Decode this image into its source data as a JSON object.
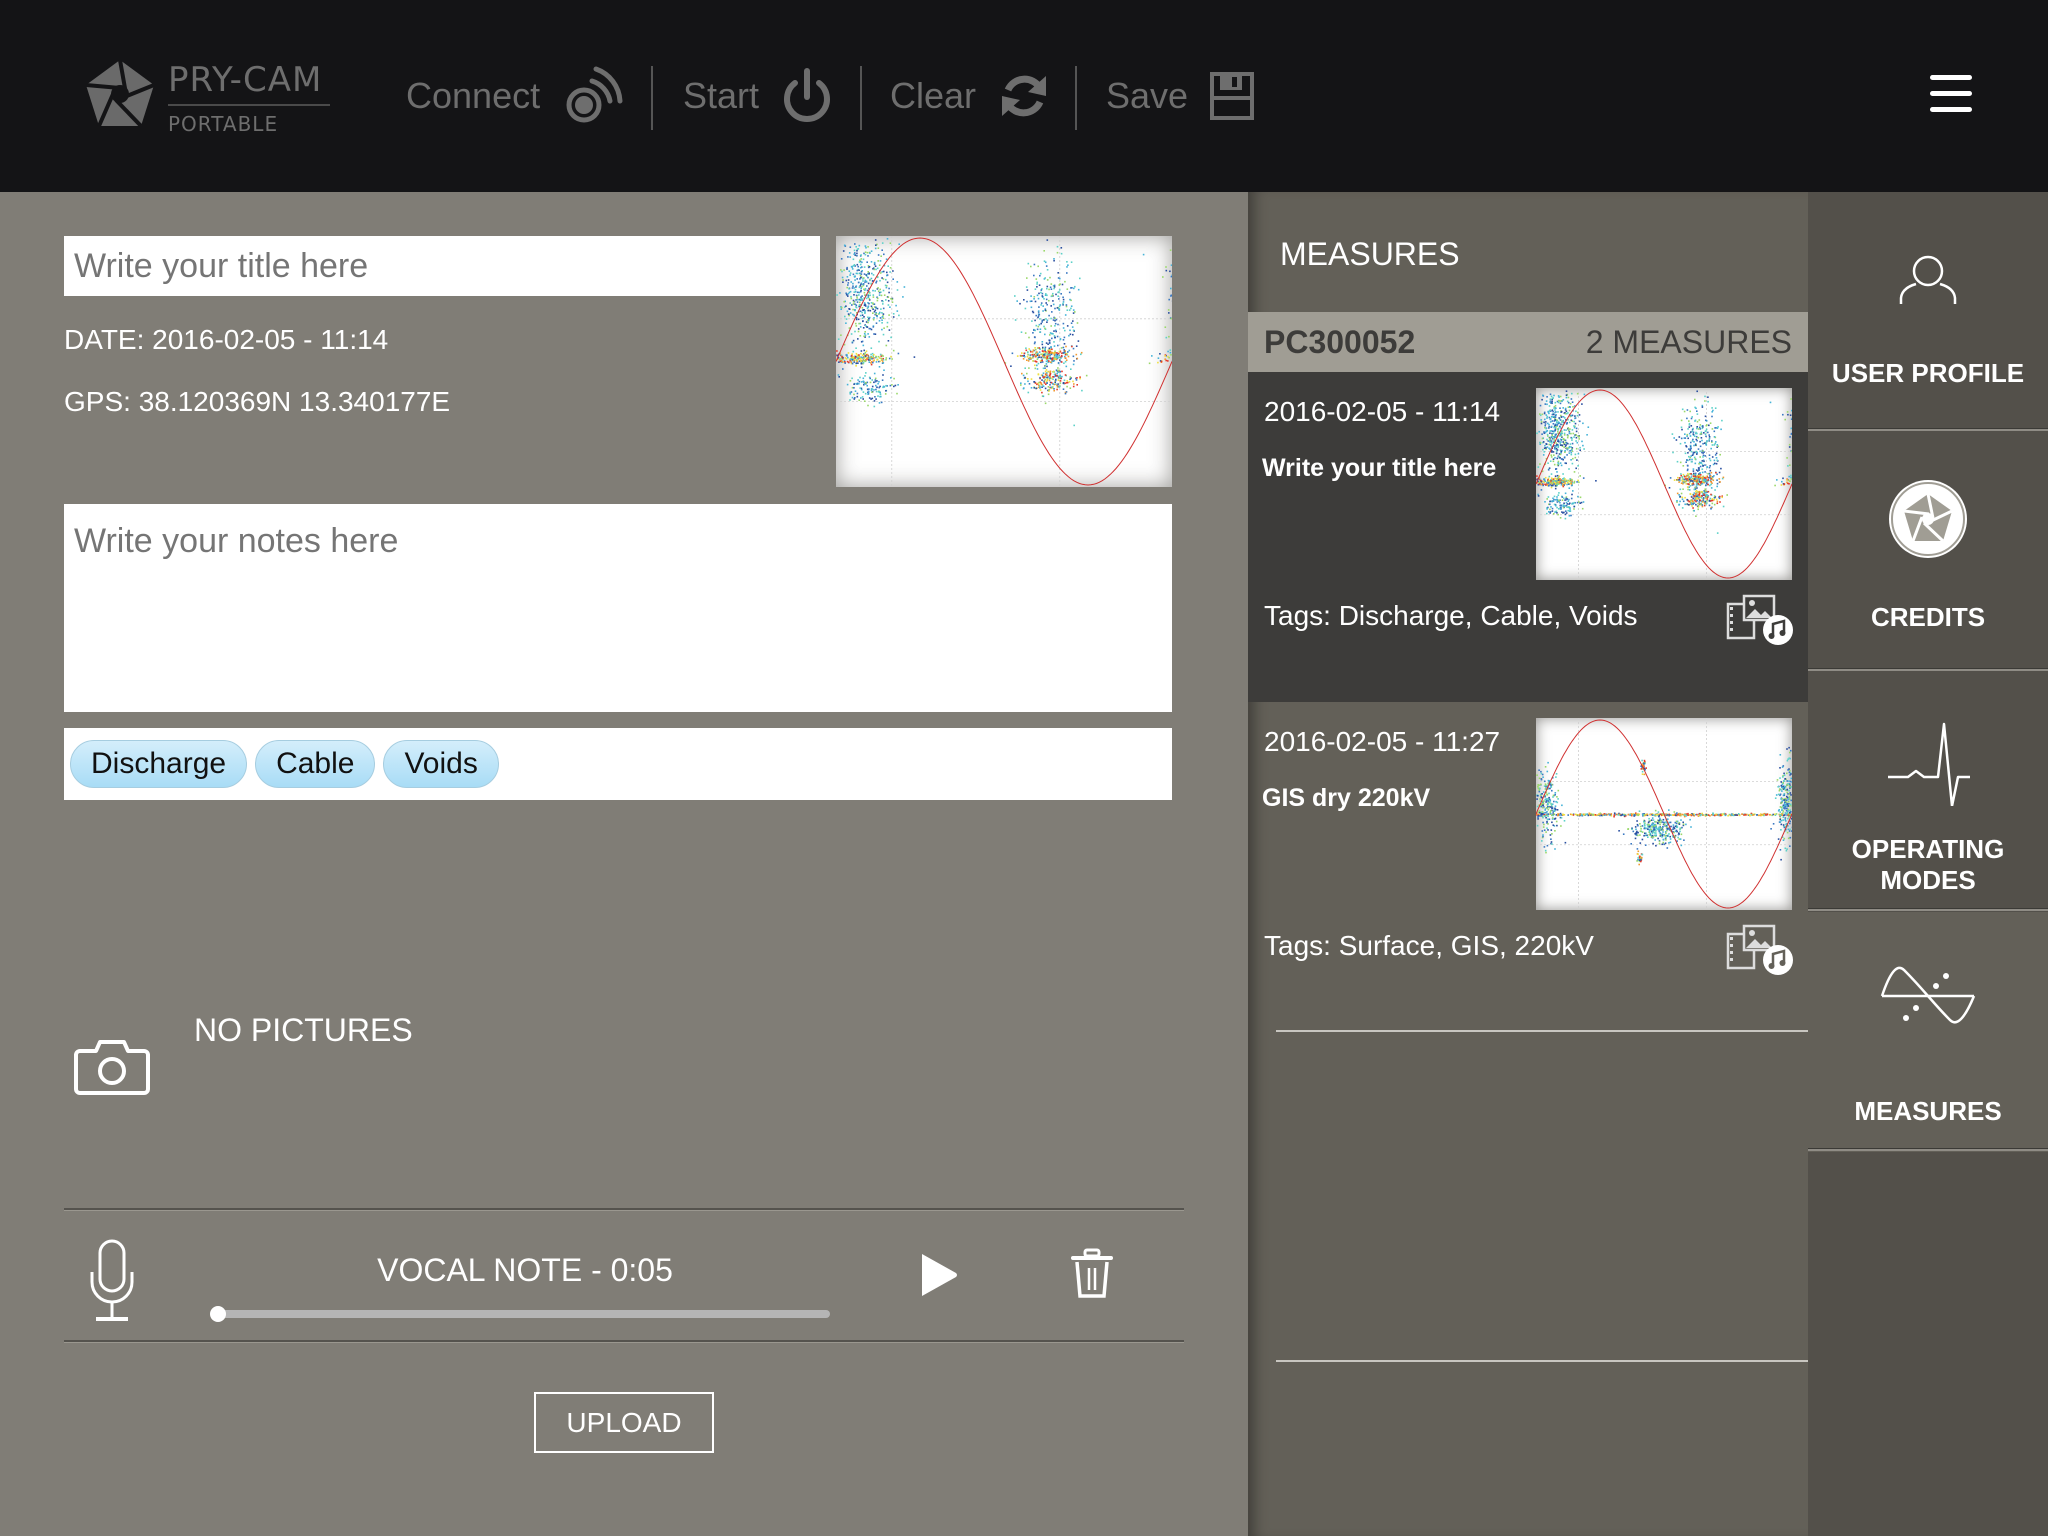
{
  "app": {
    "brand": "PRY-CAM",
    "brand_sub": "PORTABLE"
  },
  "toolbar": {
    "connect_label": "Connect",
    "start_label": "Start",
    "clear_label": "Clear",
    "save_label": "Save",
    "menu_icon": "hamburger-icon"
  },
  "editor": {
    "title_placeholder": "Write your title here",
    "date_text": "DATE: 2016-02-05  -  11:14",
    "gps_text": "GPS: 38.120369N 13.340177E",
    "notes_placeholder": "Write your notes here",
    "tags": [
      "Discharge",
      "Cable",
      "Voids"
    ],
    "pictures_text": "NO PICTURES",
    "vocal_note_label": "VOCAL NOTE - 0:05",
    "vocal_note_progress": 0,
    "upload_label": "UPLOAD"
  },
  "measures_panel": {
    "title": "MEASURES",
    "group": {
      "id": "PC300052",
      "count_label": "2 MEASURES"
    },
    "items": [
      {
        "datetime": "2016-02-05 - 11:14",
        "title": "Write your title here",
        "tags_text": "Tags: Discharge, Cable, Voids",
        "selected": true,
        "media_icon": "media-attachments-icon"
      },
      {
        "datetime": "2016-02-05 - 11:27",
        "title": "GIS dry 220kV",
        "tags_text": "Tags: Surface, GIS, 220kV",
        "selected": false,
        "media_icon": "media-attachments-icon"
      }
    ]
  },
  "sidebar": {
    "items": [
      {
        "label": "USER PROFILE",
        "icon": "user-icon",
        "active": false
      },
      {
        "label": "CREDITS",
        "icon": "aperture-logo-icon",
        "active": false
      },
      {
        "label": "OPERATING\nMODES",
        "icon": "heartbeat-icon",
        "active": false
      },
      {
        "label": "MEASURES",
        "icon": "sine-wave-icon",
        "active": true
      }
    ]
  },
  "colors": {
    "header_bg": "#141416",
    "editor_bg": "#807d76",
    "measures_bg": "#636058",
    "selected_card_bg": "#3d3c3a",
    "group_header_bg": "#a09d94",
    "sidebar_bg": "#53504a",
    "tag_chip": "#a8dcf6",
    "sine_curve": "#d03030"
  },
  "prpd_thumbnails": {
    "main": "pattern_a",
    "items": [
      "pattern_a",
      "pattern_b"
    ],
    "patterns": {
      "pattern_a": {
        "description": "phase-resolved PD pattern, clusters near 10-60 deg and 190-250 deg",
        "clusters": [
          {
            "phase": 30,
            "amp": 0.55,
            "spread_phase": 25,
            "spread_amp": 0.35,
            "n": 500
          },
          {
            "phase": 25,
            "amp": 0.03,
            "spread_phase": 30,
            "spread_amp": 0.04,
            "n": 220,
            "hot": true
          },
          {
            "phase": 35,
            "amp": -0.2,
            "spread_phase": 22,
            "spread_amp": 0.1,
            "n": 120
          },
          {
            "phase": 230,
            "amp": 0.35,
            "spread_phase": 25,
            "spread_amp": 0.45,
            "n": 320
          },
          {
            "phase": 225,
            "amp": 0.05,
            "spread_phase": 25,
            "spread_amp": 0.05,
            "n": 200,
            "hot": true
          },
          {
            "phase": 230,
            "amp": -0.15,
            "spread_phase": 22,
            "spread_amp": 0.08,
            "n": 180,
            "hot": true
          }
        ]
      },
      "pattern_b": {
        "description": "phase-resolved PD pattern, horizontal band at zero with clusters near 0, 150 and 350 deg",
        "clusters": [
          {
            "phase": 180,
            "amp": 0.0,
            "spread_phase": 180,
            "spread_amp": 0.01,
            "n": 420,
            "hot": true
          },
          {
            "phase": 170,
            "amp": -0.15,
            "spread_phase": 30,
            "spread_amp": 0.12,
            "n": 300
          },
          {
            "phase": 15,
            "amp": 0.1,
            "spread_phase": 15,
            "spread_amp": 0.3,
            "n": 220
          },
          {
            "phase": 350,
            "amp": 0.15,
            "spread_phase": 10,
            "spread_amp": 0.35,
            "n": 220
          },
          {
            "phase": 150,
            "amp": 0.5,
            "spread_phase": 3,
            "spread_amp": 0.05,
            "n": 40,
            "hot": true
          },
          {
            "phase": 145,
            "amp": -0.45,
            "spread_phase": 3,
            "spread_amp": 0.05,
            "n": 40,
            "hot": true
          }
        ]
      }
    }
  }
}
